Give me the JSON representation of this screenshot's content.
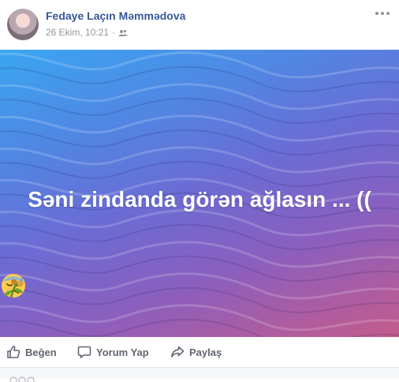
{
  "post": {
    "author": "Fedaye Laçın Məmmədova",
    "timestamp": "26 Ekim, 10:21",
    "separator": "·",
    "audience_icon": "friends-icon",
    "status_text": "Səni zindanda görən ağlasın ... ((",
    "emojis": [
      "wilted-flower-icon",
      "sad-sweat-face-icon",
      "wilted-flower-icon"
    ]
  },
  "actions": {
    "like": "Beğen",
    "comment": "Yorum Yap",
    "share": "Paylaş"
  },
  "colors": {
    "link_blue": "#365899",
    "meta_gray": "#90949c",
    "action_gray": "#606770",
    "bg_blue": "#3aa6f2",
    "bg_pink": "#c35c8c"
  }
}
